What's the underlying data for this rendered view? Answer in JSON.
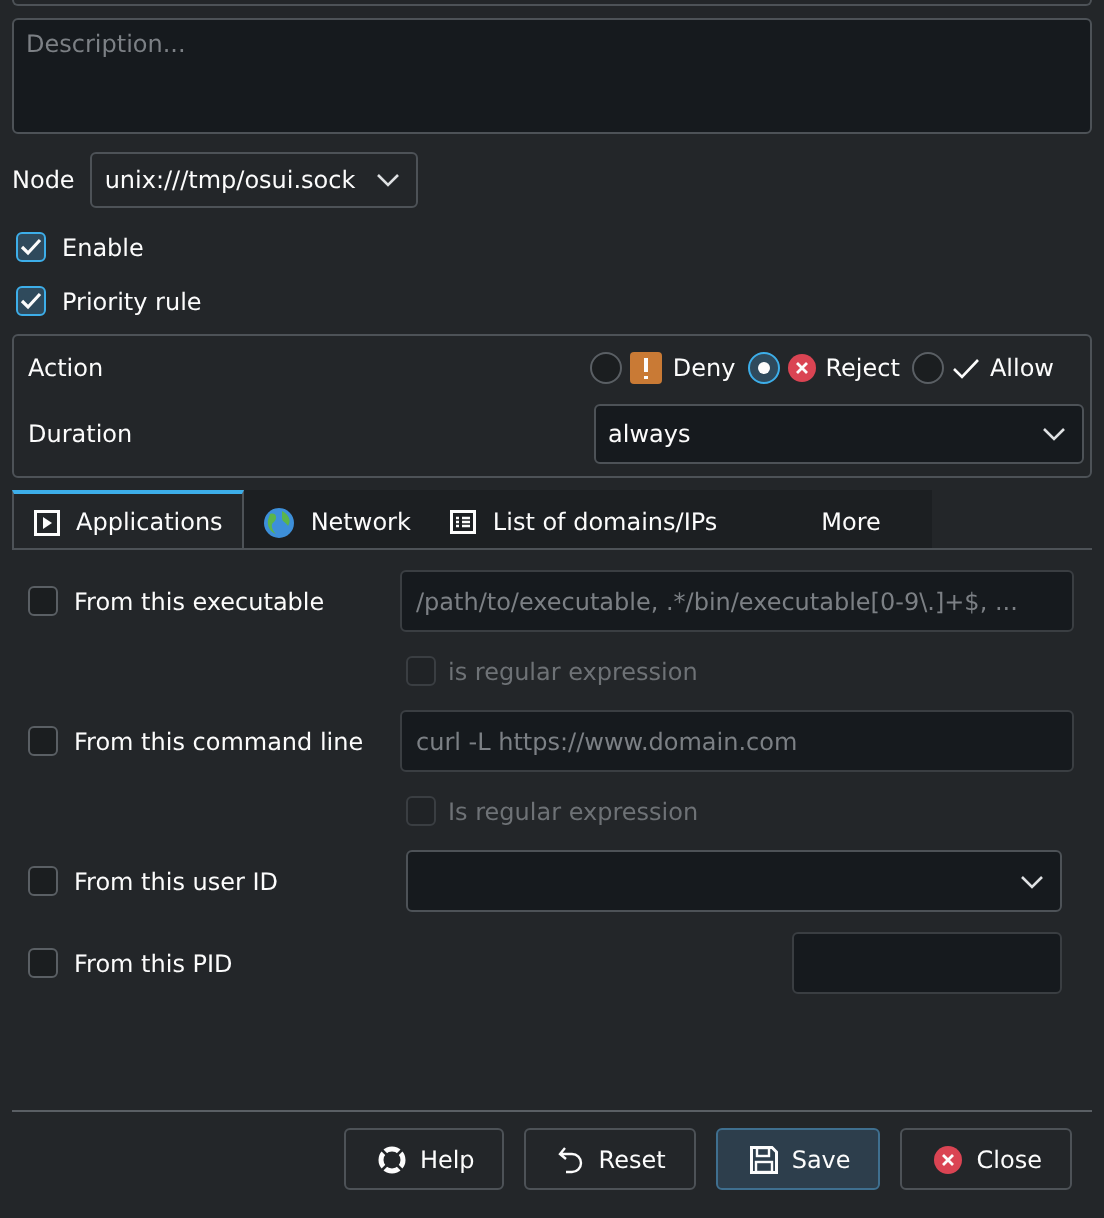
{
  "description": {
    "placeholder": "Description..."
  },
  "node": {
    "label": "Node",
    "value": "unix:///tmp/osui.sock"
  },
  "options": [
    {
      "label": "Enable",
      "checked": true
    },
    {
      "label": "Priority rule",
      "checked": true
    }
  ],
  "action": {
    "label": "Action",
    "choices": [
      {
        "label": "Deny",
        "kind": "deny",
        "selected": false
      },
      {
        "label": "Reject",
        "kind": "reject",
        "selected": true
      },
      {
        "label": "Allow",
        "kind": "allow",
        "selected": false
      }
    ]
  },
  "duration": {
    "label": "Duration",
    "value": "always"
  },
  "tabs": [
    {
      "label": "Applications",
      "kind": "apps",
      "selected": true
    },
    {
      "label": "Network",
      "kind": "network",
      "selected": false
    },
    {
      "label": "List of domains/IPs",
      "kind": "list",
      "selected": false
    },
    {
      "label": "More",
      "kind": "more",
      "selected": false
    }
  ],
  "criteria": [
    {
      "label": "From this executable",
      "checked": false,
      "kind": "text",
      "placeholder": "/path/to/executable, .*/bin/executable[0-9\\.]+$, ...",
      "regex": {
        "label": "is regular expression",
        "checked": false,
        "disabled": true
      }
    },
    {
      "label": "From this command line",
      "checked": false,
      "kind": "text",
      "placeholder": "curl -L https://www.domain.com",
      "regex": {
        "label": "Is regular expression",
        "checked": false,
        "disabled": true
      }
    },
    {
      "label": "From this user ID",
      "checked": false,
      "kind": "combo"
    },
    {
      "label": "From this PID",
      "checked": false,
      "kind": "short"
    }
  ],
  "buttons": [
    {
      "label": "Help",
      "kind": "help",
      "default": false
    },
    {
      "label": "Reset",
      "kind": "reset",
      "default": false
    },
    {
      "label": "Save",
      "kind": "save",
      "default": true
    },
    {
      "label": "Close",
      "kind": "close",
      "default": false
    }
  ]
}
